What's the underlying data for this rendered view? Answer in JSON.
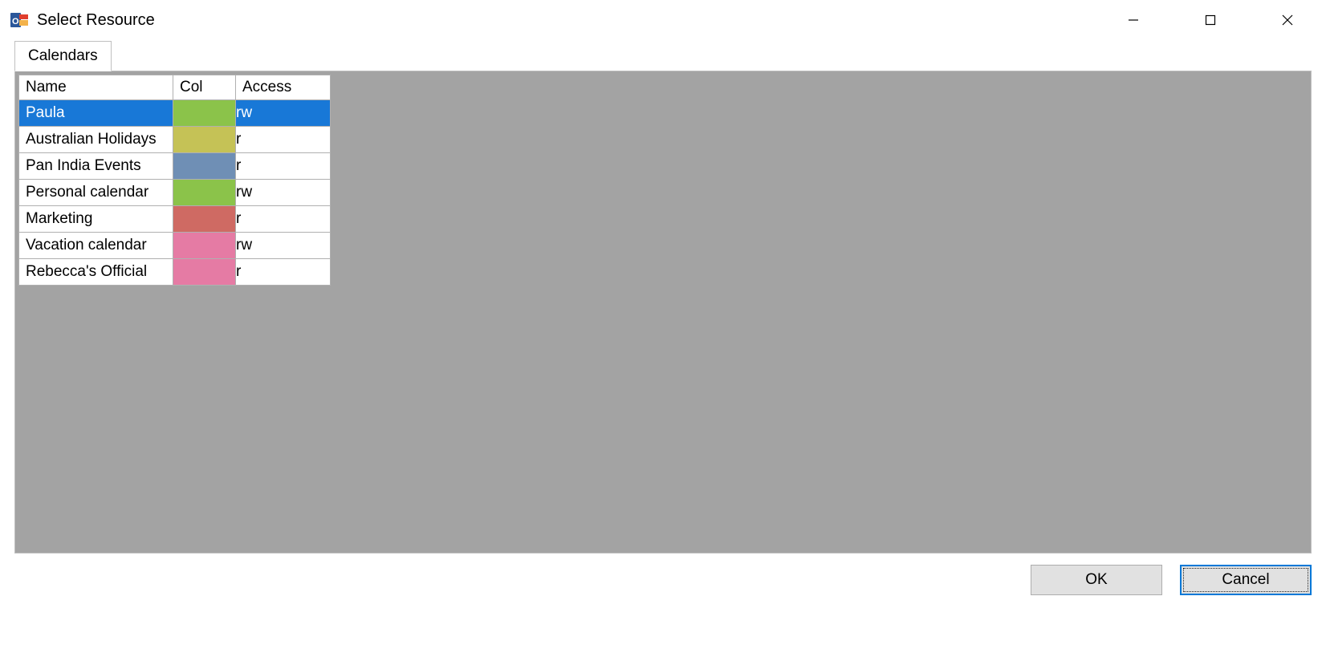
{
  "window": {
    "title": "Select Resource"
  },
  "tabs": [
    {
      "label": "Calendars"
    }
  ],
  "table": {
    "columns": {
      "name": "Name",
      "col": "Col",
      "access": "Access"
    },
    "rows": [
      {
        "name": "Paula",
        "color": "#8bc34a",
        "access": "rw",
        "selected": true
      },
      {
        "name": "Australian Holidays",
        "color": "#c5c256",
        "access": "r",
        "selected": false
      },
      {
        "name": "Pan India Events",
        "color": "#6f8fb5",
        "access": "r",
        "selected": false
      },
      {
        "name": "Personal calendar",
        "color": "#8bc34a",
        "access": "rw",
        "selected": false
      },
      {
        "name": "Marketing",
        "color": "#cf6a63",
        "access": "r",
        "selected": false
      },
      {
        "name": "Vacation calendar",
        "color": "#e57ba4",
        "access": "rw",
        "selected": false
      },
      {
        "name": "Rebecca's Official",
        "color": "#e57ba4",
        "access": "r",
        "selected": false
      }
    ]
  },
  "buttons": {
    "ok": "OK",
    "cancel": "Cancel"
  }
}
